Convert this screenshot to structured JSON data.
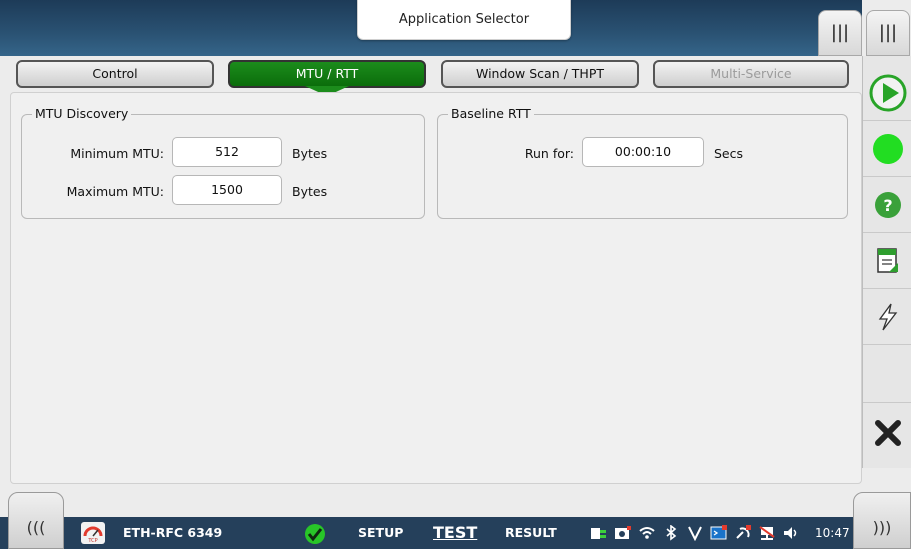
{
  "header": {
    "app_selector_label": "Application Selector"
  },
  "top_tabs": {
    "left_label": "|||",
    "right_label": "|||"
  },
  "tabs": [
    {
      "label": "Control",
      "state": "normal"
    },
    {
      "label": "MTU / RTT",
      "state": "active"
    },
    {
      "label": "Window Scan / THPT",
      "state": "normal"
    },
    {
      "label": "Multi-Service",
      "state": "disabled"
    }
  ],
  "mtu_discovery": {
    "title": "MTU Discovery",
    "min_label": "Minimum MTU:",
    "min_value": "512",
    "min_unit": "Bytes",
    "max_label": "Maximum MTU:",
    "max_value": "1500",
    "max_unit": "Bytes"
  },
  "baseline_rtt": {
    "title": "Baseline RTT",
    "run_label": "Run for:",
    "run_value": "00:00:10",
    "run_unit": "Secs"
  },
  "sidebar": {
    "icons": [
      "play-icon",
      "status-green-icon",
      "help-icon",
      "report-icon",
      "lightning-icon",
      "close-icon"
    ]
  },
  "bottom_bar": {
    "left_corner": "(((",
    "right_corner": ")))",
    "test_name": "ETH-RFC 6349",
    "setup_label": "SETUP",
    "test_label": "TEST",
    "result_label": "RESULT",
    "time": "10:47"
  },
  "colors": {
    "header": "#2a5273",
    "active_tab": "#1c8c1c",
    "bottom_bar": "#25405b",
    "status_green": "#22dd22"
  }
}
